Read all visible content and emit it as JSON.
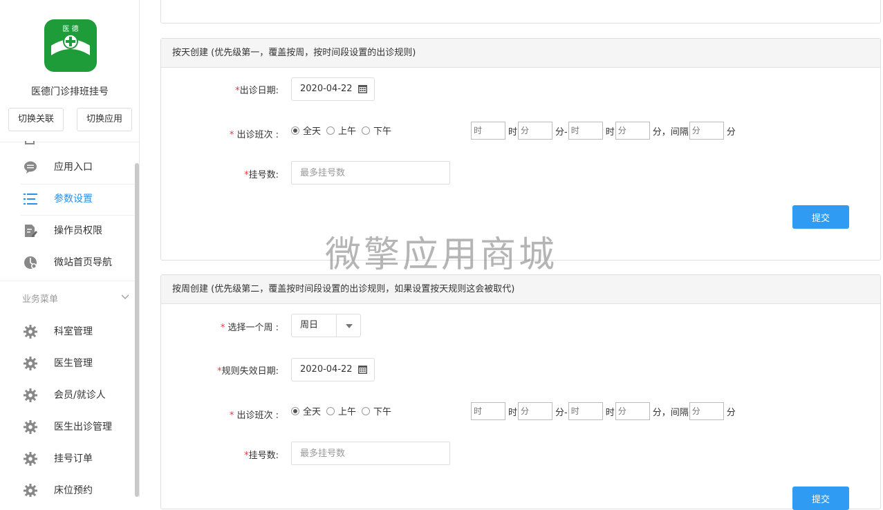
{
  "app": {
    "name": "医德门诊排班挂号",
    "logo_text": "医 德",
    "switch_link_label": "切换关联",
    "switch_app_label": "切换应用"
  },
  "sidebar": {
    "items": [
      {
        "label": "应用入口",
        "icon": "chat-bubble-icon"
      },
      {
        "label": "参数设置",
        "icon": "list-icon",
        "active": true
      },
      {
        "label": "操作员权限",
        "icon": "edit-document-icon"
      },
      {
        "label": "微站首页导航",
        "icon": "compass-user-icon"
      }
    ],
    "group_title": "业务菜单",
    "business_items": [
      {
        "label": "科室管理",
        "icon": "gear-icon"
      },
      {
        "label": "医生管理",
        "icon": "gear-icon"
      },
      {
        "label": "会员/就诊人",
        "icon": "gear-icon"
      },
      {
        "label": "医生出诊管理",
        "icon": "gear-icon"
      },
      {
        "label": "挂号订单",
        "icon": "gear-icon"
      },
      {
        "label": "床位预约",
        "icon": "gear-icon"
      }
    ]
  },
  "day_panel": {
    "title": "按天创建 (优先级第一，覆盖按周，按时间段设置的出诊规则)",
    "date_label": "出诊日期:",
    "date_value": "2020-04-22",
    "shift_label": " 出诊班次 :",
    "shift_options": [
      "全天",
      "上午",
      "下午"
    ],
    "shift_selected": "全天",
    "time_placeholders": {
      "hour": "时",
      "minute": "分"
    },
    "time_units": {
      "hour": "时",
      "minute_dash": "分-",
      "interval": "分，间隔",
      "minute": "分"
    },
    "count_label": "挂号数:",
    "count_placeholder": "最多挂号数",
    "submit_label": "提交"
  },
  "week_panel": {
    "title": "按周创建 (优先级第二，覆盖按时间段设置的出诊规则，如果设置按天规则这会被取代)",
    "week_label": " 选择一个周 :",
    "week_value": "周日",
    "expire_label": "规则失效日期:",
    "expire_value": "2020-04-22",
    "shift_label": " 出诊班次 :",
    "shift_options": [
      "全天",
      "上午",
      "下午"
    ],
    "shift_selected": "全天",
    "count_label": "挂号数:",
    "count_placeholder": "最多挂号数",
    "submit_label": "提交"
  },
  "watermark": "微擎应用商城",
  "colors": {
    "accent": "#2f9bf2",
    "active_nav": "#2b8fe8",
    "required": "#e4393c",
    "logo_bg": "#1f9c3a"
  }
}
